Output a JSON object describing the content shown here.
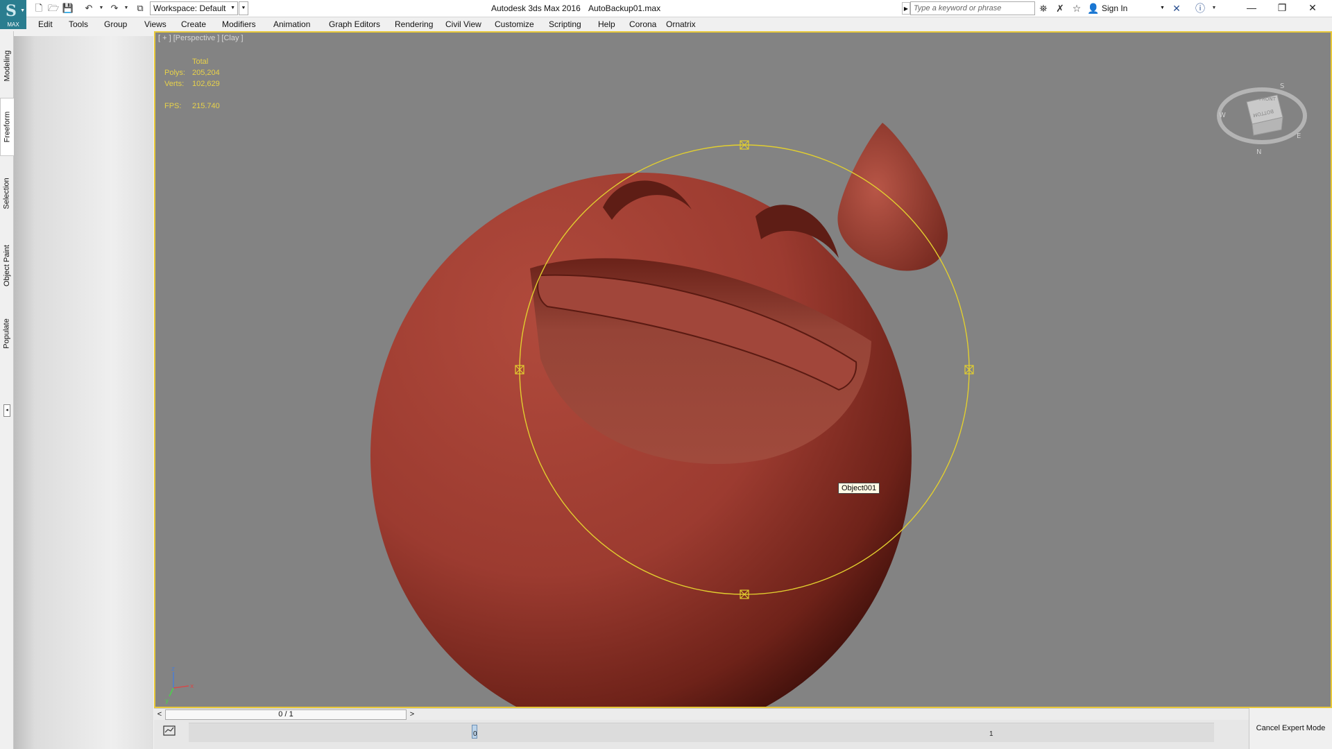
{
  "app": {
    "logo_text": "MAX",
    "title": "Autodesk 3ds Max 2016",
    "file": "AutoBackup01.max"
  },
  "quick_access": {
    "workspace": "Workspace: Default",
    "search_placeholder": "Type a keyword or phrase",
    "sign_in": "Sign In",
    "icons": [
      "new-icon",
      "open-icon",
      "save-icon",
      "undo-icon",
      "redo-icon",
      "project-folder-icon"
    ]
  },
  "menu": [
    "Edit",
    "Tools",
    "Group",
    "Views",
    "Create",
    "Modifiers",
    "Animation",
    "Graph Editors",
    "Rendering",
    "Civil View",
    "Customize",
    "Scripting",
    "Help",
    "Corona",
    "Ornatrix"
  ],
  "side_tabs": [
    "Modeling",
    "Freeform",
    "Selection",
    "Object Paint",
    "Populate"
  ],
  "side_tabs_active": "Freeform",
  "viewport": {
    "label": "[ + ] [Perspective ] [Clay ]",
    "stats": {
      "header": "Total",
      "polys_label": "Polys:",
      "polys": "205,204",
      "verts_label": "Verts:",
      "verts": "102,629",
      "fps_label": "FPS:",
      "fps": "215.740"
    },
    "tooltip": "Object001",
    "model_color": "#a54236",
    "selection_color": "#e2cf2f",
    "border_color": "#e9c939",
    "axis": {
      "z": "z",
      "x": "x",
      "y": "y"
    },
    "viewcube_faces": {
      "front": "FRONT",
      "bottom": "BOTTOM"
    },
    "compass": {
      "w": "W",
      "n": "N",
      "s": "S",
      "e": "E"
    }
  },
  "timeline": {
    "position": "0 / 1",
    "prev": "<",
    "next": ">",
    "track_start": "0",
    "track_end": "1"
  },
  "cancel_expert_mode": "Cancel Expert Mode"
}
